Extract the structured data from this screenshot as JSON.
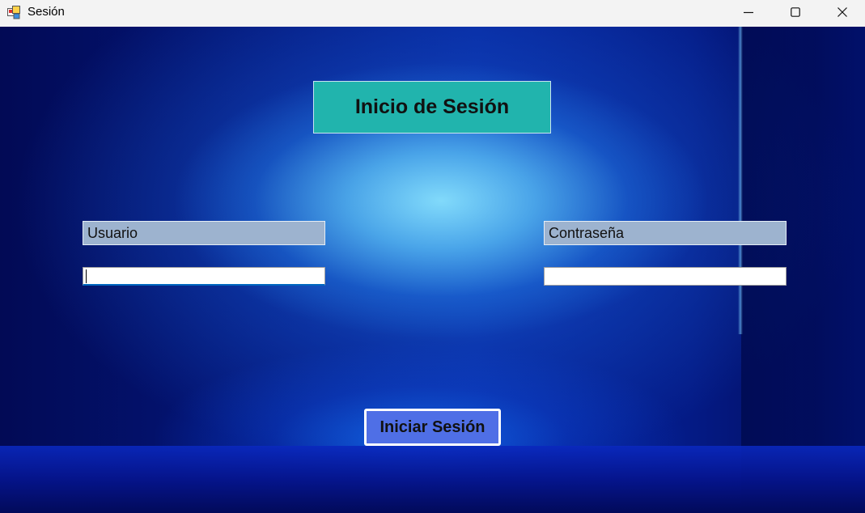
{
  "window": {
    "title": "Sesión",
    "icons": {
      "app": "app-icon",
      "minimize": "minimize-icon",
      "maximize": "maximize-icon",
      "close": "close-icon"
    }
  },
  "form": {
    "header": "Inicio de Sesión",
    "username_label": "Usuario",
    "username_value": "",
    "password_label": "Contraseña",
    "password_value": "",
    "submit_label": "Iniciar Sesión"
  },
  "colors": {
    "header_bg": "#21b4ad",
    "label_bg": "#9db3cf",
    "button_bg": "#4f6fe6",
    "background_dark": "#020a55"
  }
}
